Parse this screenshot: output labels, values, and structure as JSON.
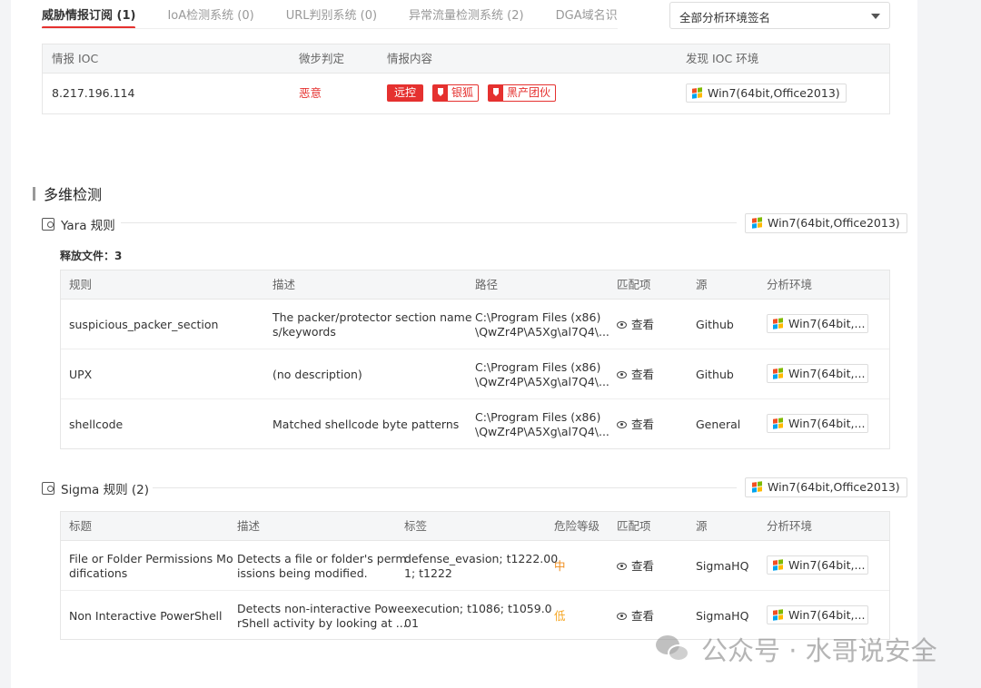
{
  "tabs": [
    {
      "label": "威胁情报订阅 (1)"
    },
    {
      "label": "IoA检测系统 (0)"
    },
    {
      "label": "URL判别系统 (0)"
    },
    {
      "label": "异常流量检测系统 (2)"
    },
    {
      "label": "DGA域名识别系"
    }
  ],
  "env_select": {
    "value": "全部分析环境签名"
  },
  "ioc_table": {
    "headers": [
      "情报 IOC",
      "微步判定",
      "情报内容",
      "发现 IOC 环境"
    ],
    "rows": [
      {
        "ioc": "8.217.196.114",
        "verdict": "恶意",
        "tags": [
          "远控",
          "银狐",
          "黑产团伙"
        ],
        "env": "Win7(64bit,Office2013)"
      }
    ]
  },
  "section_title": "多维检测",
  "yara": {
    "title": "Yara 规则",
    "env": "Win7(64bit,Office2013)",
    "release_label": "释放文件：3",
    "headers": [
      "规则",
      "描述",
      "路径",
      "匹配项",
      "源",
      "分析环境"
    ],
    "rows": [
      {
        "rule": "suspicious_packer_section",
        "desc1": "The packer/protector section name",
        "desc2": "s/keywords",
        "path1": "C:\\Program Files (x86)",
        "path2": "\\QwZr4P\\A5Xg\\al7Q4\\...",
        "match": "查看",
        "source": "Github",
        "env": "Win7(64bit,..."
      },
      {
        "rule": "UPX",
        "desc1": "(no description)",
        "desc2": "",
        "path1": "C:\\Program Files (x86)",
        "path2": "\\QwZr4P\\A5Xg\\al7Q4\\...",
        "match": "查看",
        "source": "Github",
        "env": "Win7(64bit,..."
      },
      {
        "rule": "shellcode",
        "desc1": "Matched shellcode byte patterns",
        "desc2": "",
        "path1": "C:\\Program Files (x86)",
        "path2": "\\QwZr4P\\A5Xg\\al7Q4\\...",
        "match": "查看",
        "source": "General",
        "env": "Win7(64bit,..."
      }
    ]
  },
  "sigma": {
    "title": "Sigma 规则 (2)",
    "env": "Win7(64bit,Office2013)",
    "headers": [
      "标题",
      "描述",
      "标签",
      "危险等级",
      "匹配项",
      "源",
      "分析环境"
    ],
    "rows": [
      {
        "title1": "File or Folder Permissions Mo",
        "title2": "difications",
        "desc1": "Detects a file or folder's perm",
        "desc2": "issions being modified.",
        "tags1": "defense_evasion; t1222.00",
        "tags2": "1; t1222",
        "level": "中",
        "match": "查看",
        "source": "SigmaHQ",
        "env": "Win7(64bit,..."
      },
      {
        "title1": "Non Interactive PowerShell",
        "title2": "",
        "desc1": "Detects non-interactive Powe",
        "desc2": "rShell activity by looking at ...",
        "tags1": "execution; t1086; t1059.0",
        "tags2": "01",
        "level": "低",
        "match": "查看",
        "source": "SigmaHQ",
        "env": "Win7(64bit,..."
      }
    ]
  },
  "watermark": "公众号 · 水哥说安全"
}
